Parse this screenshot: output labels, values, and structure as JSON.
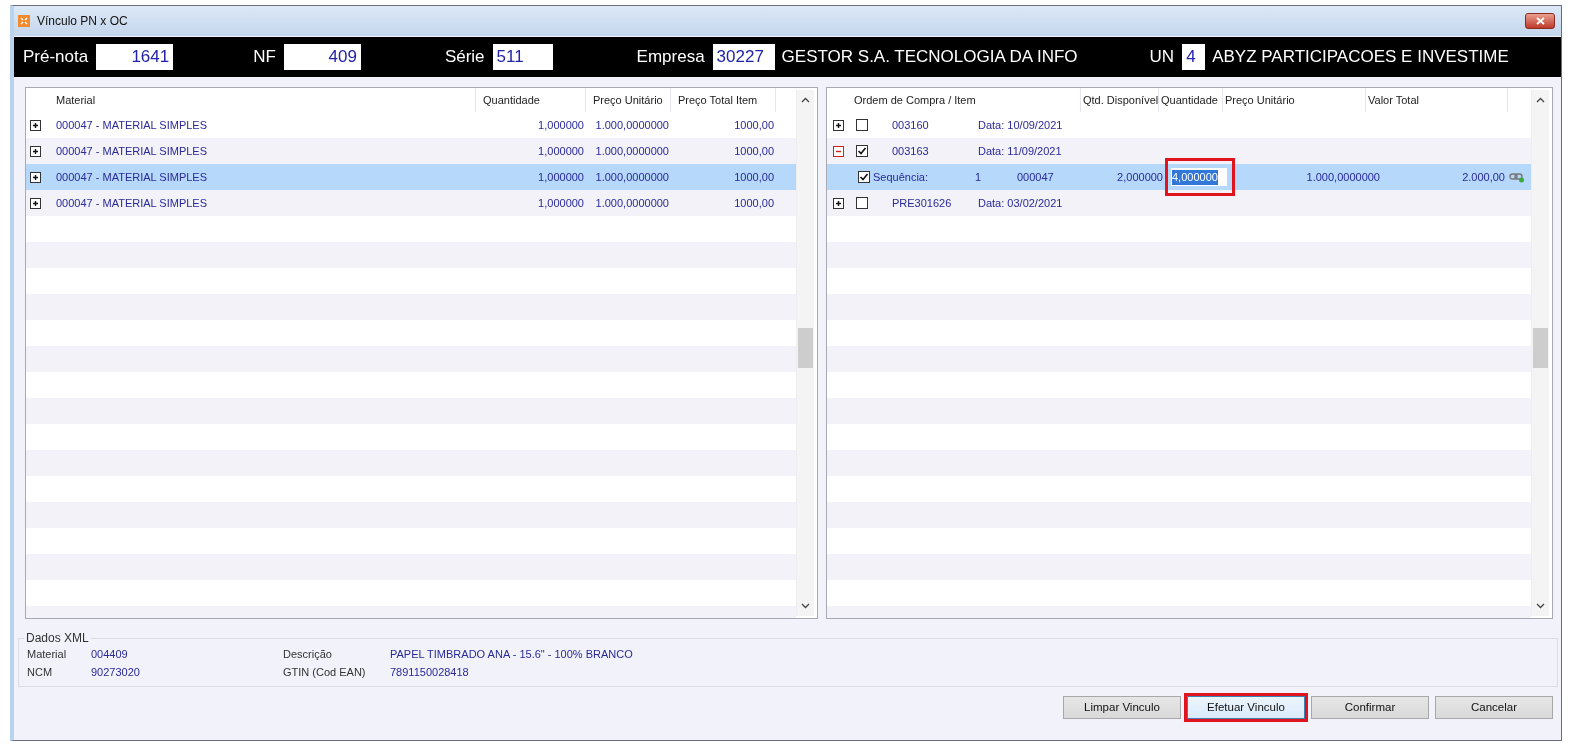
{
  "window": {
    "title": "Vínculo PN x OC"
  },
  "header": {
    "fields": [
      {
        "label": "Pré-nota",
        "value": "1641"
      },
      {
        "label": "NF",
        "value": "409"
      },
      {
        "label": "Série",
        "value": "511"
      },
      {
        "label": "Empresa",
        "value": "30227",
        "description": "GESTOR S.A. TECNOLOGIA DA INFO"
      },
      {
        "label": "UN",
        "value": "4",
        "description": "ABYZ PARTICIPACOES E INVESTIME"
      }
    ]
  },
  "materials_grid": {
    "columns": [
      "Material",
      "Quantidade",
      "Preço Unitário",
      "Preço Total Item"
    ],
    "rows": [
      {
        "expanded": false,
        "selected": false,
        "cells": [
          "000047 - MATERIAL SIMPLES",
          "1,000000",
          "1.000,0000000",
          "1000,00"
        ]
      },
      {
        "expanded": false,
        "selected": false,
        "cells": [
          "000047 - MATERIAL SIMPLES",
          "1,000000",
          "1.000,0000000",
          "1000,00"
        ]
      },
      {
        "expanded": false,
        "selected": true,
        "cells": [
          "000047 - MATERIAL SIMPLES",
          "1,000000",
          "1.000,0000000",
          "1000,00"
        ]
      },
      {
        "expanded": false,
        "selected": false,
        "cells": [
          "000047 - MATERIAL SIMPLES",
          "1,000000",
          "1.000,0000000",
          "1000,00"
        ]
      }
    ]
  },
  "orders_grid": {
    "columns": [
      "Ordem de Compra / Item",
      "Qtd. Disponível",
      "Quantidade",
      "Preço Unitário",
      "Valor Total"
    ],
    "rows": [
      {
        "kind": "order",
        "expanded": false,
        "checked": false,
        "selected": false,
        "number": "003160",
        "date": "Data: 10/09/2021"
      },
      {
        "kind": "order",
        "expanded": true,
        "checked": true,
        "selected": false,
        "number": "003163",
        "date": "Data: 11/09/2021"
      },
      {
        "kind": "item",
        "checked": true,
        "selected": true,
        "highlighted": true,
        "label": "Sequência:",
        "sequence": "1",
        "material": "000047",
        "available": "2,000000",
        "quantity": "4,000000",
        "unit_price": "1.000,0000000",
        "total": "2.000,00"
      },
      {
        "kind": "order",
        "expanded": false,
        "checked": false,
        "selected": false,
        "number": "PRE301626",
        "date": "Data: 03/02/2021"
      }
    ]
  },
  "dados_xml": {
    "title": "Dados XML",
    "fields": [
      {
        "label": "Material",
        "value": "004409"
      },
      {
        "label": "Descrição",
        "value": "PAPEL TIMBRADO ANA - 15.6\" - 100% BRANCO"
      },
      {
        "label": "NCM",
        "value": "90273020"
      },
      {
        "label": "GTIN (Cod EAN)",
        "value": "7891150028418"
      }
    ]
  },
  "buttons": [
    {
      "label": "Limpar Vinculo",
      "focused": false,
      "highlighted": false
    },
    {
      "label": "Efetuar Vinculo",
      "focused": true,
      "highlighted": true
    },
    {
      "label": "Confirmar",
      "focused": false,
      "highlighted": false
    },
    {
      "label": "Cancelar",
      "focused": false,
      "highlighted": false
    }
  ]
}
